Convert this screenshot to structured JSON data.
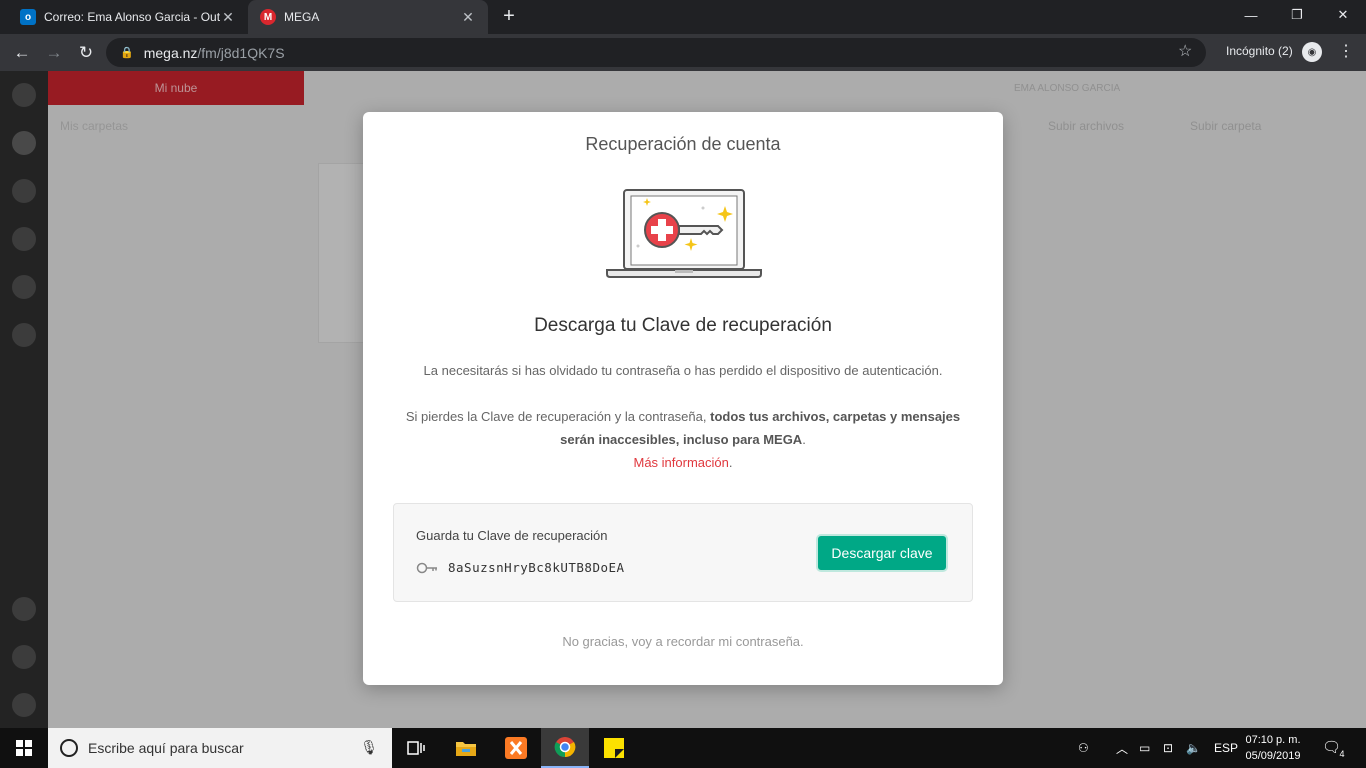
{
  "browser": {
    "tabs": [
      {
        "title": "Correo: Ema Alonso Garcia - Outl",
        "icon": "outlook-icon",
        "active": false
      },
      {
        "title": "MEGA",
        "icon": "mega-icon",
        "active": true
      }
    ],
    "url_host": "mega.nz",
    "url_path": "/fm/j8d1QK7S",
    "incognito_label": "Incógnito (2)"
  },
  "app_background": {
    "red_bar_label": "Mi nube",
    "tree_header": "Mis carpetas",
    "user_name": "EMA ALONSO GARCIA",
    "upload_files": "Subir archivos",
    "upload_folder": "Subir carpeta"
  },
  "modal": {
    "title": "Recuperación de cuenta",
    "heading": "Descarga tu Clave de recuperación",
    "paragraph1": "La necesitarás si has olvidado tu contraseña o has perdido el dispositivo de autenticación.",
    "paragraph2_normal": "Si pierdes la Clave de recuperación y la contraseña,",
    "paragraph2_bold": "todos tus archivos, carpetas y mensajes serán inaccesibles, incluso para MEGA",
    "paragraph2_end": ".",
    "more_info_link": "Más información",
    "more_info_end": ".",
    "save_key_label": "Guarda tu Clave de recuperación",
    "recovery_key": "8aSuzsnHryBc8kUTB8DoEA",
    "download_button": "Descargar clave",
    "decline_link": "No gracias, voy a recordar mi contraseña."
  },
  "taskbar": {
    "search_placeholder": "Escribe aquí para buscar",
    "language": "ESP",
    "time": "07:10 p. m.",
    "date": "05/09/2019",
    "notification_count": "4"
  },
  "colors": {
    "accent_green": "#00a886",
    "link_red": "#e0383e",
    "mega_red": "#d9272e"
  }
}
